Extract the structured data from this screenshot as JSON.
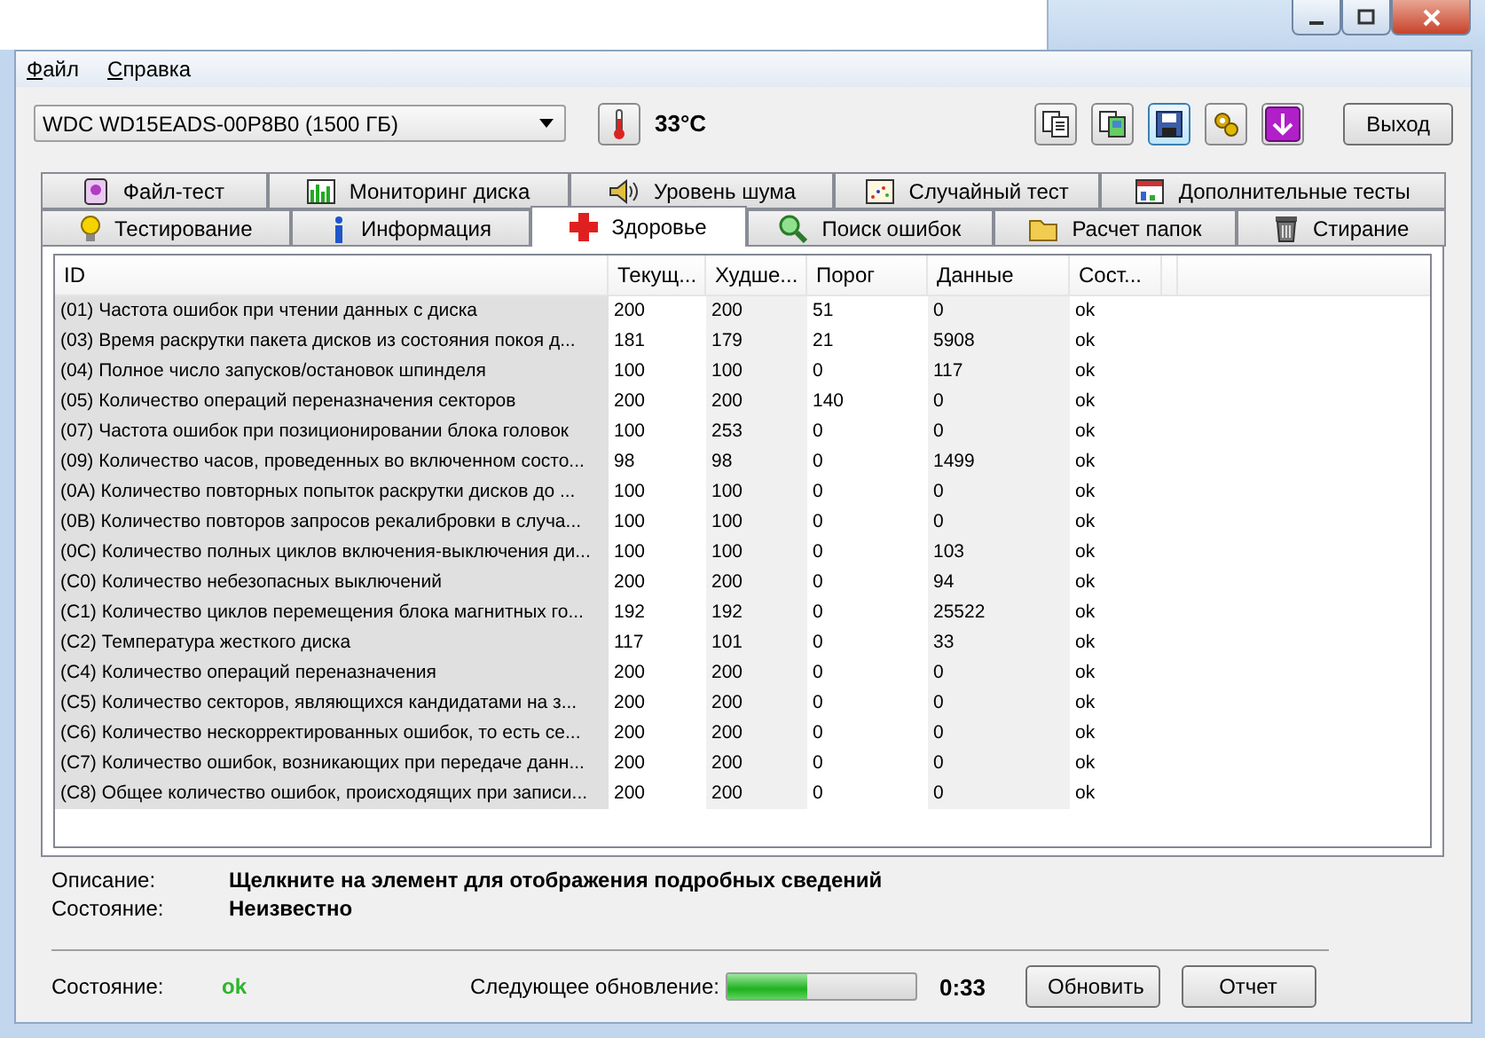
{
  "window": {
    "controls": [
      {
        "kind": "minimize"
      },
      {
        "kind": "maximize"
      },
      {
        "kind": "close"
      }
    ]
  },
  "menu": [
    {
      "label": "Файл"
    },
    {
      "label": "Справка"
    }
  ],
  "drive_select": {
    "value": "WDC WD15EADS-00P8B0 (1500 ГБ)"
  },
  "temperature": "33°C",
  "tools": [
    {
      "kind": "copy-text",
      "selected": false
    },
    {
      "kind": "copy-image",
      "selected": false
    },
    {
      "kind": "save",
      "selected": true
    },
    {
      "kind": "options",
      "selected": false
    },
    {
      "kind": "download",
      "selected": false
    }
  ],
  "exit_button": "Выход",
  "tab_rows": [
    [
      {
        "label": "Файл-тест",
        "kind": "file",
        "selected": false
      },
      {
        "label": "Мониторинг диска",
        "kind": "chart",
        "selected": false
      },
      {
        "label": "Уровень шума",
        "kind": "speaker",
        "selected": false
      },
      {
        "label": "Случайный тест",
        "kind": "dots",
        "selected": false
      },
      {
        "label": "Дополнительные тесты",
        "kind": "window",
        "selected": false
      }
    ],
    [
      {
        "label": "Тестирование",
        "kind": "bulb",
        "selected": false
      },
      {
        "label": "Информация",
        "kind": "info",
        "selected": false
      },
      {
        "label": "Здоровье",
        "kind": "cross",
        "selected": true
      },
      {
        "label": "Поиск ошибок",
        "kind": "magnifier",
        "selected": false
      },
      {
        "label": "Расчет папок",
        "kind": "folder",
        "selected": false
      },
      {
        "label": "Стирание",
        "kind": "bin",
        "selected": false
      }
    ]
  ],
  "table": {
    "columns": [
      "ID",
      "Текущ...",
      "Худше...",
      "Порог",
      "Данные",
      "Сост..."
    ],
    "rows": [
      [
        "(01) Частота ошибок при чтении данных с диска",
        "200",
        "200",
        "51",
        "0",
        "ok"
      ],
      [
        "(03) Время раскрутки пакета дисков из состояния покоя д...",
        "181",
        "179",
        "21",
        "5908",
        "ok"
      ],
      [
        "(04) Полное число запусков/остановок шпинделя",
        "100",
        "100",
        "0",
        "117",
        "ok"
      ],
      [
        "(05) Количество операций переназначения секторов",
        "200",
        "200",
        "140",
        "0",
        "ok"
      ],
      [
        "(07) Частота ошибок при позиционировании блока головок",
        "100",
        "253",
        "0",
        "0",
        "ok"
      ],
      [
        "(09) Количество часов, проведенных во включенном состо...",
        "98",
        "98",
        "0",
        "1499",
        "ok"
      ],
      [
        "(0A) Количество повторных попыток раскрутки дисков до ...",
        "100",
        "100",
        "0",
        "0",
        "ok"
      ],
      [
        "(0B) Количество повторов запросов рекалибровки в случа...",
        "100",
        "100",
        "0",
        "0",
        "ok"
      ],
      [
        "(0C) Количество полных циклов включения-выключения ди...",
        "100",
        "100",
        "0",
        "103",
        "ok"
      ],
      [
        "(C0) Количество небезопасных выключений",
        "200",
        "200",
        "0",
        "94",
        "ok"
      ],
      [
        "(C1) Количество циклов перемещения блока магнитных го...",
        "192",
        "192",
        "0",
        "25522",
        "ok"
      ],
      [
        "(C2) Температура жесткого диска",
        "117",
        "101",
        "0",
        "33",
        "ok"
      ],
      [
        "(C4) Количество операций переназначения",
        "200",
        "200",
        "0",
        "0",
        "ok"
      ],
      [
        "(C5) Количество секторов, являющихся кандидатами на з...",
        "200",
        "200",
        "0",
        "0",
        "ok"
      ],
      [
        "(C6) Количество нескорректированных ошибок, то есть се...",
        "200",
        "200",
        "0",
        "0",
        "ok"
      ],
      [
        "(C7) Количество ошибок, возникающих при передаче данн...",
        "200",
        "200",
        "0",
        "0",
        "ok"
      ],
      [
        "(C8) Общее количество ошибок, происходящих при записи...",
        "200",
        "200",
        "0",
        "0",
        "ok"
      ]
    ]
  },
  "details": [
    {
      "label": "Описание:",
      "value": "Щелкните на элемент для отображения подробных сведений"
    },
    {
      "label": "Состояние:",
      "value": "Неизвестно"
    }
  ],
  "status": {
    "label": "Состояние:",
    "value": "ok",
    "next_label": "Следующее обновление:",
    "level": 0.42,
    "time": "0:33",
    "buttons": [
      "Обновить",
      "Отчет"
    ]
  }
}
